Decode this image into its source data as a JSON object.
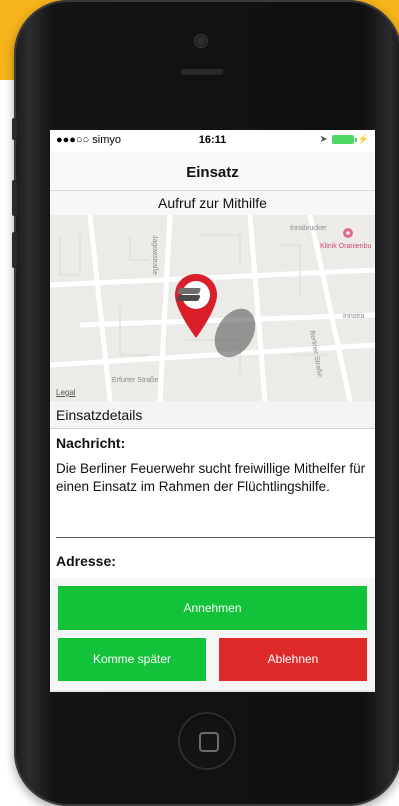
{
  "status_bar": {
    "carrier": "●●●○○ simyo",
    "time": "16:11"
  },
  "navbar": {
    "title": "Einsatz"
  },
  "section_header": "Aufruf zur Mithilfe",
  "map": {
    "labels": {
      "street_1": "Jagowstraße",
      "street_2": "Innsbrucker",
      "street_3": "Klinik Oranienbu",
      "street_4": "Berliner Straße",
      "street_5": "Erfurter Straße",
      "street_6": "Innstra",
      "legal": "Legal"
    },
    "pin_color": "#d9202a"
  },
  "details": {
    "header": "Einsatzdetails",
    "message_label": "Nachricht:",
    "message_text": "Die Berliner Feuerwehr sucht freiwillige Mithelfer für einen Einsatz im Rahmen der Flüchtlingshilfe.",
    "address_label": "Adresse:"
  },
  "actions": {
    "accept": "Annehmen",
    "later": "Komme später",
    "decline": "Ablehnen"
  },
  "colors": {
    "accent_yellow": "#f7b31b",
    "accept_green": "#12c33a",
    "decline_red": "#df2a2a"
  }
}
